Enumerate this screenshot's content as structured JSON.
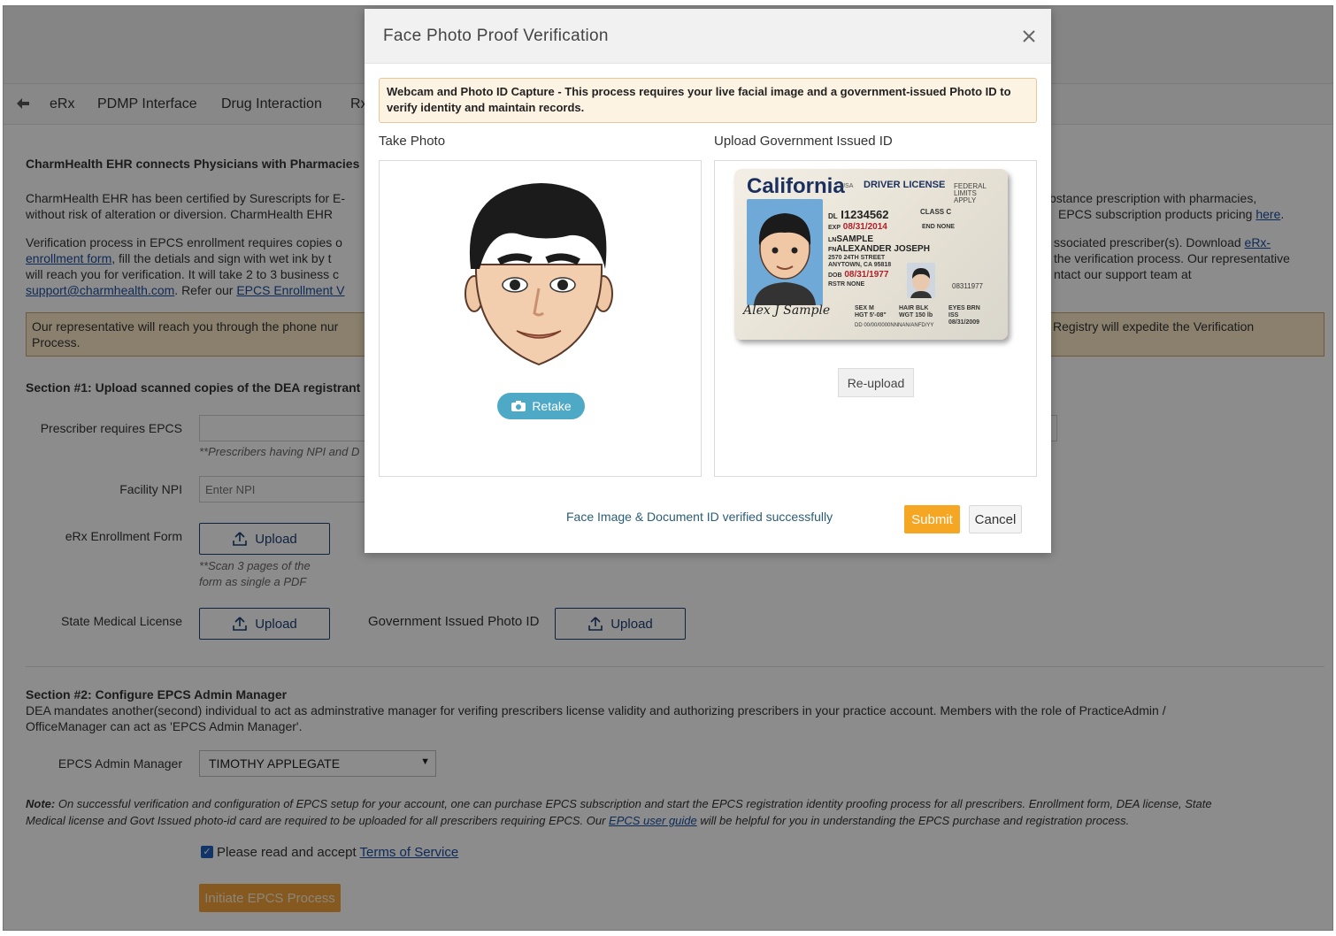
{
  "tabs": [
    "eRx",
    "PDMP Interface",
    "Drug Interaction",
    "Rx"
  ],
  "page": {
    "heading": "CharmHealth EHR connects Physicians with Pharmacies",
    "para1_left_l1": "CharmHealth EHR has been certified by Surescripts for E-",
    "para1_left_l2": "without risk of alteration or diversion. CharmHealth EHR",
    "para1_right_l1": "bstance prescription with pharmacies,",
    "para1_right_l2": "EPCS subscription products pricing",
    "para1_here_link": "here",
    "para2_left_l1": "Verification process in EPCS enrollment requires copies o",
    "para2_link_enroll_a": "enrollment form",
    "para2_left_l2b": ", fill the detials and sign with wet ink by t",
    "para2_left_l3": "will reach you for verification. It will take 2 to 3 business c",
    "para2_email_link": "support@charmhealth.com",
    "para2_refer": ". Refer our",
    "para2_epcs_link": "EPCS Enrollment V",
    "para2_right_l1": "ssociated prescriber(s). Download",
    "para2_right_link": "eRx-",
    "para2_right_l2": "the verification process. Our representative",
    "para2_right_l3": "ntact our support team at",
    "notice_left_l1": "Our representative will reach you through the phone nur",
    "notice_left_l2": "Process.",
    "notice_right": "Registry will expedite the Verification",
    "section1_title": "Section #1: Upload scanned copies of the DEA registrant",
    "prescriber_label": "Prescriber requires EPCS",
    "prescriber_hint": "**Prescribers having NPI and D",
    "facility_npi_label": "Facility NPI",
    "facility_npi_placeholder": "Enter NPI",
    "erx_form_label": "eRx Enrollment Form",
    "upload_label": "Upload",
    "scan_hint_l1": "**Scan 3 pages of the",
    "scan_hint_l2": "form as single a PDF",
    "state_license_label": "State Medical License",
    "gov_photo_label": "Government Issued Photo ID",
    "section2_title": "Section #2: Configure EPCS Admin Manager",
    "section2_l1": "DEA mandates another(second) individual to act as adminstrative manager for verifing prescribers license validity and authorizing prescribers in your practice account. Members with the role of PracticeAdmin /",
    "section2_l2": "OfficeManager can act as 'EPCS Admin Manager'.",
    "admin_manager_label": "EPCS Admin Manager",
    "admin_manager_value": "TIMOTHY APPLEGATE",
    "note_bold": "Note:",
    "note_l1": " On successful verification and configuration of EPCS setup for your account, one can purchase EPCS subscription and start the EPCS registration identity proofing process for all prescribers. Enrollment form, DEA license, State",
    "note_l2a": "Medical license and Govt Issued photo-id card are required to be uploaded for all prescribers requiring EPCS. Our",
    "note_link": "EPCS user guide",
    "note_l2b": "will be helpful for you in understanding the EPCS purchase and registration process.",
    "terms_text": "Please read and accept",
    "terms_link": "Terms of Service",
    "initiate_button": "Initiate EPCS Process"
  },
  "modal": {
    "title": "Face Photo Proof Verification",
    "info": "Webcam and Photo ID Capture - This process requires your live facial image and a government-issued Photo ID to verify identity and maintain records.",
    "take_photo_label": "Take Photo",
    "upload_id_label": "Upload Government Issued ID",
    "retake_button": "Retake",
    "reupload_button": "Re-upload",
    "status_message": "Face Image & Document ID verified successfully",
    "submit_button": "Submit",
    "cancel_button": "Cancel"
  },
  "license_card": {
    "state": "California",
    "usa": "USA",
    "type": "DRIVER LICENSE",
    "federal": "FEDERAL",
    "limits": "LIMITS",
    "apply": "APPLY",
    "dl_prefix": "DL",
    "dl_number": "I1234562",
    "class": "CLASS C",
    "exp_prefix": "EXP",
    "exp": "08/31/2014",
    "end": "END NONE",
    "ln_prefix": "LN",
    "last_name": "SAMPLE",
    "fn_prefix": "FN",
    "first_name": "ALEXANDER JOSEPH",
    "addr1": "2570 24TH STREET",
    "addr2": "ANYTOWN, CA 95818",
    "dob_prefix": "DOB",
    "dob": "08/31/1977",
    "rstr": "RSTR NONE",
    "id_small": "08311977",
    "sex": "SEX M",
    "hair": "HAIR BLK",
    "eyes": "EYES BRN",
    "hgt": "HGT 5'-08\"",
    "wgt": "WGT 150 lb",
    "iss_label": "ISS",
    "iss": "08/31/2009",
    "dd": "DD 00/00/0000NNNAN/ANFD/YY",
    "signature": "Alex J Sample"
  },
  "colors": {
    "accent_orange": "#f5a623",
    "retake_teal": "#4da9c6",
    "link_blue": "#1a4ea0",
    "notice_bg": "#fbe9c7"
  }
}
